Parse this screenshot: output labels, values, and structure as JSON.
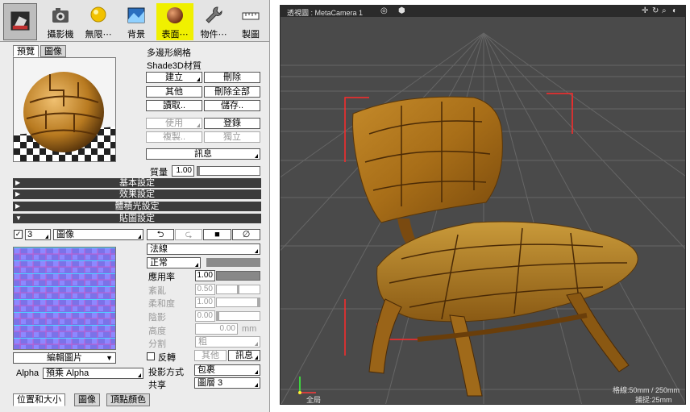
{
  "toolbar": {
    "items": [
      {
        "label": "",
        "icon": "shade-tool-icon"
      },
      {
        "label": "攝影機",
        "icon": "camera-icon"
      },
      {
        "label": "無限⋯",
        "icon": "light-bulb-icon"
      },
      {
        "label": "背景",
        "icon": "background-icon"
      },
      {
        "label": "表面⋯",
        "icon": "sphere-material-icon"
      },
      {
        "label": "物件⋯",
        "icon": "wrench-icon"
      },
      {
        "label": "製圖",
        "icon": "ruler-icon"
      }
    ]
  },
  "preview": {
    "tabs": [
      "預覽",
      "圖像"
    ]
  },
  "material": {
    "object_type": "多邊形網格",
    "material_name": "Shade3D材質",
    "buttons": {
      "create": "建立",
      "delete": "刪除",
      "other": "其他",
      "delete_all": "刪除全部",
      "load": "讀取..",
      "save": "儲存..",
      "use": "使用",
      "register": "登錄",
      "duplicate": "複製..",
      "independent": "獨立",
      "info": "訊息"
    },
    "mass_label": "質量",
    "mass_value": "1.00"
  },
  "sections": [
    "基本設定",
    "效果設定",
    "體積光設定",
    "貼圖設定"
  ],
  "mapping": {
    "layer_number": "3",
    "layer_type": "圖像",
    "tool_icons": [
      "undo-icon",
      "redo-icon",
      "square-icon",
      "null-icon"
    ],
    "map_type": "法線",
    "blend_mode": "正常",
    "edit_image": "編輯圖片",
    "alpha_label": "Alpha",
    "alpha_value": "預乘 Alpha",
    "params": [
      {
        "label": "應用率",
        "value": "1.00",
        "enabled": true,
        "fill": 1.0
      },
      {
        "label": "紊亂",
        "value": "0.50",
        "enabled": false,
        "fill": 0.5
      },
      {
        "label": "柔和度",
        "value": "1.00",
        "enabled": false,
        "fill": 1.0
      },
      {
        "label": "陰影",
        "value": "0.00",
        "enabled": false,
        "fill": 0.0
      }
    ],
    "height_label": "高度",
    "height_value": "0.00",
    "height_unit": "mm",
    "split_label": "分割",
    "split_value": "粗",
    "invert_label": "反轉",
    "other_button": "其他",
    "info_button": "訊息",
    "projection_label": "投影方式",
    "projection_value": "包裹",
    "share_label": "共享",
    "share_value": "圖層 3"
  },
  "bottom_tabs": [
    "位置和大小",
    "圖像",
    "頂點顏色"
  ],
  "viewport": {
    "title": "透視圖 : MetaCamera 1",
    "grid_label": "格線:50mm / 250mm",
    "snap_label": "捕捉:25mm",
    "axis_label": "全局",
    "colors": {
      "bg": "#4a4a4a",
      "header": "#2b2b2b",
      "grid": "#6a6a6a",
      "bbox": "#ff2a2a",
      "wood": "#b07a20"
    }
  }
}
